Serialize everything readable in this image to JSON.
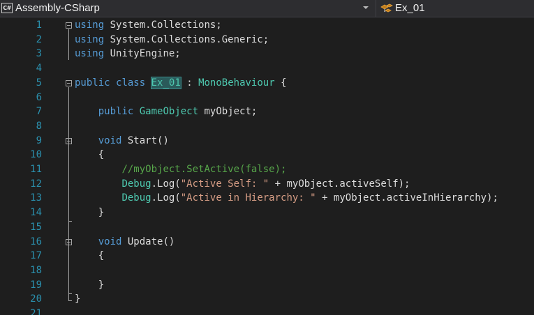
{
  "navbar": {
    "project_icon": "csharp-project-icon",
    "project_icon_text": "C#",
    "project": "Assembly-CSharp",
    "class_icon": "class-member-icon",
    "class": "Ex_01"
  },
  "editor": {
    "line_numbers": [
      "1",
      "2",
      "3",
      "4",
      "5",
      "6",
      "7",
      "8",
      "9",
      "10",
      "11",
      "12",
      "13",
      "14",
      "15",
      "16",
      "17",
      "18",
      "19",
      "20",
      "21"
    ],
    "lines": [
      [
        {
          "t": "kw",
          "v": "using"
        },
        {
          "t": "pl",
          "v": " System.Collections;"
        }
      ],
      [
        {
          "t": "kw",
          "v": "using"
        },
        {
          "t": "pl",
          "v": " System.Collections.Generic;"
        }
      ],
      [
        {
          "t": "kw",
          "v": "using"
        },
        {
          "t": "pl",
          "v": " UnityEngine;"
        }
      ],
      [],
      [
        {
          "t": "kw",
          "v": "public"
        },
        {
          "t": "pl",
          "v": " "
        },
        {
          "t": "kw",
          "v": "class"
        },
        {
          "t": "pl",
          "v": " "
        },
        {
          "t": "hl",
          "v": "Ex_01"
        },
        {
          "t": "pl",
          "v": " : "
        },
        {
          "t": "ty",
          "v": "MonoBehaviour"
        },
        {
          "t": "pl",
          "v": " {"
        }
      ],
      [],
      [
        {
          "t": "pl",
          "v": "    "
        },
        {
          "t": "kw",
          "v": "public"
        },
        {
          "t": "pl",
          "v": " "
        },
        {
          "t": "ty",
          "v": "GameObject"
        },
        {
          "t": "pl",
          "v": " myObject;"
        }
      ],
      [],
      [
        {
          "t": "pl",
          "v": "    "
        },
        {
          "t": "kw",
          "v": "void"
        },
        {
          "t": "pl",
          "v": " Start()"
        }
      ],
      [
        {
          "t": "pl",
          "v": "    {"
        }
      ],
      [
        {
          "t": "pl",
          "v": "        "
        },
        {
          "t": "cm",
          "v": "//myObject.SetActive(false);"
        }
      ],
      [
        {
          "t": "pl",
          "v": "        "
        },
        {
          "t": "ty",
          "v": "Debug"
        },
        {
          "t": "pl",
          "v": ".Log("
        },
        {
          "t": "st",
          "v": "\"Active Self: \""
        },
        {
          "t": "pl",
          "v": " + myObject.activeSelf);"
        }
      ],
      [
        {
          "t": "pl",
          "v": "        "
        },
        {
          "t": "ty",
          "v": "Debug"
        },
        {
          "t": "pl",
          "v": ".Log("
        },
        {
          "t": "st",
          "v": "\"Active in Hierarchy: \""
        },
        {
          "t": "pl",
          "v": " + myObject.activeInHierarchy);"
        }
      ],
      [
        {
          "t": "pl",
          "v": "    }"
        }
      ],
      [],
      [
        {
          "t": "pl",
          "v": "    "
        },
        {
          "t": "kw",
          "v": "void"
        },
        {
          "t": "pl",
          "v": " Update()"
        }
      ],
      [
        {
          "t": "pl",
          "v": "    {"
        }
      ],
      [],
      [
        {
          "t": "pl",
          "v": "    }"
        }
      ],
      [
        {
          "t": "pl",
          "v": "}"
        }
      ],
      []
    ]
  }
}
